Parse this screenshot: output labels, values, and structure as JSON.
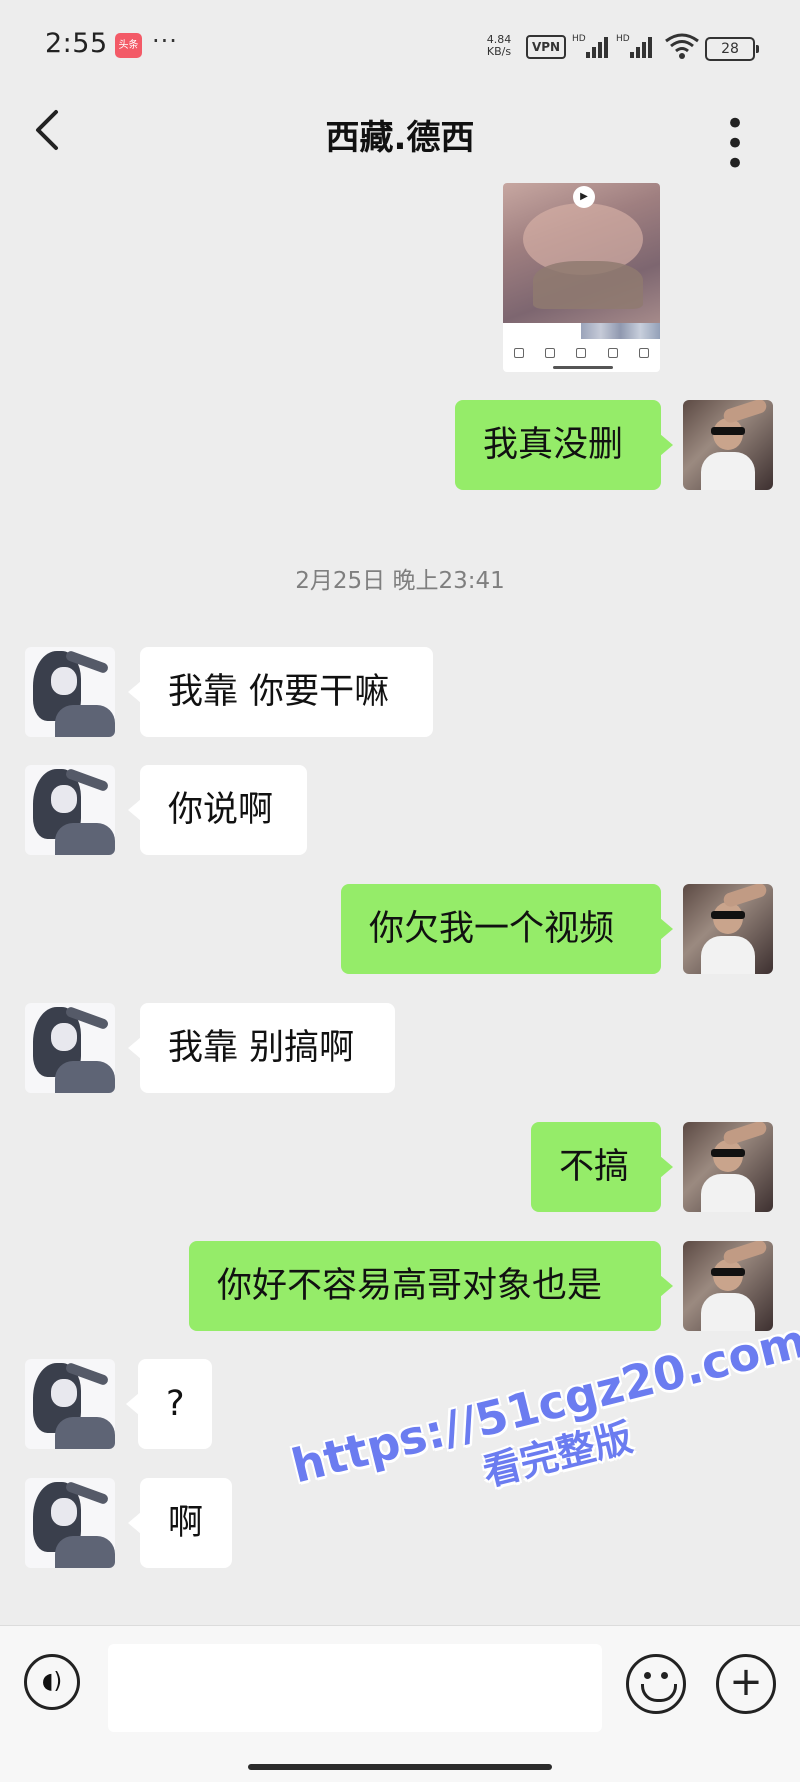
{
  "status_bar": {
    "time": "2:55",
    "app_badge": "头条",
    "dots": "···",
    "net_speed_value": "4.84",
    "net_speed_unit": "KB/s",
    "vpn": "VPN",
    "battery": "28"
  },
  "header": {
    "title": "西藏.德西"
  },
  "timestamp": "2月25日 晚上23:41",
  "messages": [
    {
      "side": "out",
      "text": "我真没删"
    },
    {
      "side": "in",
      "text": "我靠 你要干嘛"
    },
    {
      "side": "in",
      "text": "你说啊"
    },
    {
      "side": "out",
      "text": "你欠我一个视频"
    },
    {
      "side": "in",
      "text": "我靠 别搞啊"
    },
    {
      "side": "out",
      "text": "不搞"
    },
    {
      "side": "out",
      "text": "你好不容易高哥对象也是"
    },
    {
      "side": "in",
      "text": "?"
    },
    {
      "side": "in",
      "text": "啊"
    }
  ],
  "watermark": {
    "url": "https://51cgz20.com",
    "text": "看完整版"
  },
  "colors": {
    "outgoing_bubble": "#95ec69",
    "incoming_bubble": "#ffffff",
    "background": "#ededed",
    "watermark": "#6b7cf0"
  },
  "icons": {
    "back": "chevron-left-icon",
    "more": "more-horizontal-icon",
    "voice": "voice-icon",
    "emoji": "emoji-icon",
    "plus": "plus-icon"
  }
}
